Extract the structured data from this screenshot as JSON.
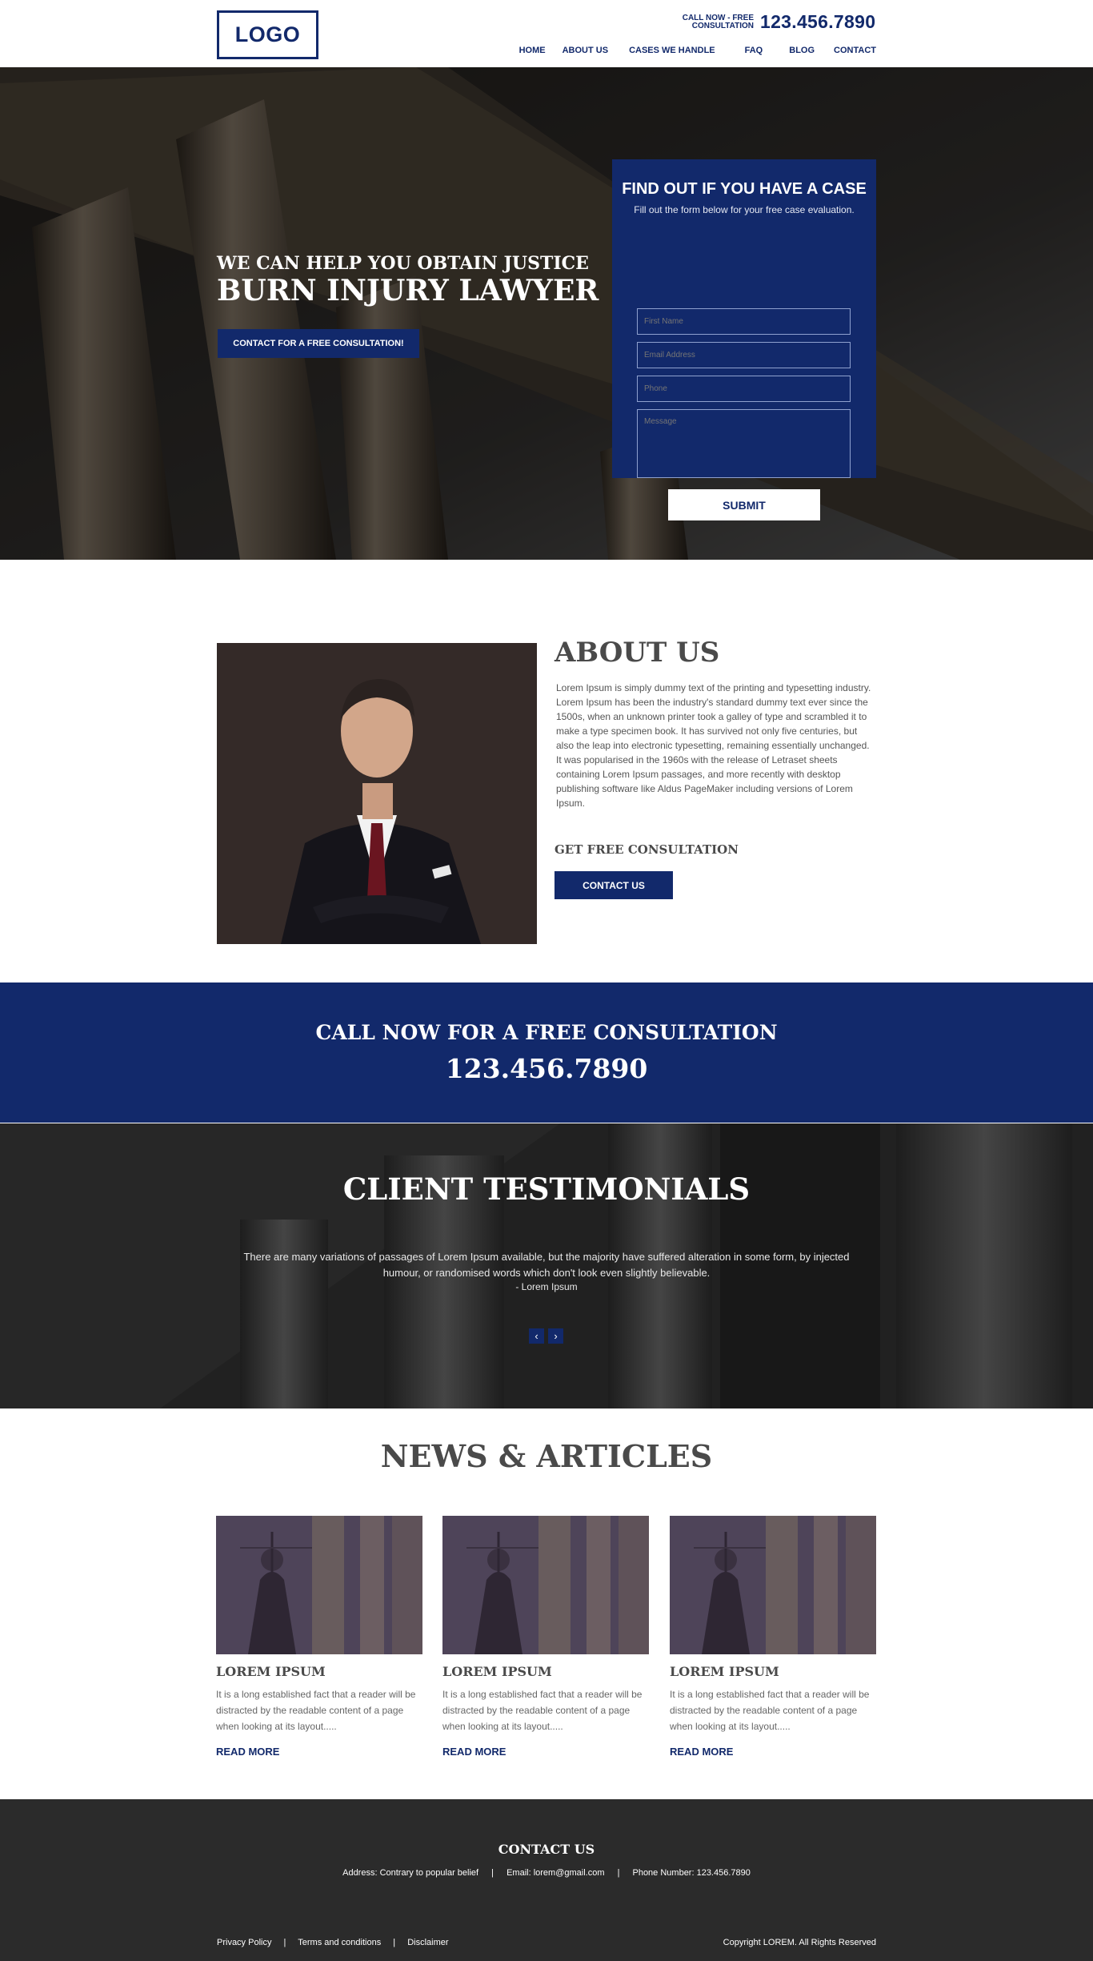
{
  "header": {
    "logo": "LOGO",
    "call_label": "CALL NOW - FREE CONSULTATION",
    "phone": "123.456.7890",
    "nav": [
      "HOME",
      "ABOUT US",
      "CASES WE HANDLE",
      "FAQ",
      "BLOG",
      "CONTACT"
    ]
  },
  "hero": {
    "subtitle": "WE CAN HELP YOU OBTAIN JUSTICE",
    "title": "BURN INJURY LAWYER",
    "cta": "CONTACT FOR A FREE CONSULTATION!"
  },
  "form": {
    "title": "FIND OUT IF YOU HAVE A CASE",
    "subtitle": "Fill out the form below for your free case evaluation.",
    "first_name_placeholder": "First Name",
    "email_placeholder": "Email Address",
    "phone_placeholder": "Phone",
    "message_placeholder": "Message",
    "submit": "SUBMIT"
  },
  "about": {
    "title": "ABOUT US",
    "text": "Lorem Ipsum is simply dummy text of the printing and typesetting industry. Lorem Ipsum has been the industry's standard dummy text ever since the 1500s, when an unknown printer took a galley of type and scrambled it to make a type specimen book. It has survived not only five centuries, but also the leap into electronic typesetting, remaining essentially unchanged. It was popularised in the 1960s with the release of Letraset sheets containing Lorem Ipsum passages, and more recently with desktop publishing software like Aldus PageMaker including versions of Lorem Ipsum.",
    "consult_label": "GET FREE CONSULTATION",
    "button": "CONTACT US"
  },
  "call_band": {
    "title": "CALL NOW FOR A FREE CONSULTATION",
    "phone": "123.456.7890"
  },
  "testimonials": {
    "title": "CLIENT TESTIMONIALS",
    "quote": "There are many variations of passages of Lorem Ipsum available, but the majority have suffered alteration in some form, by injected humour, or randomised words which don't look even slightly believable.",
    "author": "- Lorem Ipsum",
    "prev": "‹",
    "next": "›"
  },
  "news": {
    "title": "NEWS & ARTICLES",
    "cards": [
      {
        "title": "LOREM IPSUM",
        "text": "It is a long established fact that a reader will be distracted by the readable content of a page when looking at its layout.....",
        "link": "READ MORE"
      },
      {
        "title": "LOREM IPSUM",
        "text": "It is a long established fact that a reader will be distracted by the readable content of a page when looking at its layout.....",
        "link": "READ MORE"
      },
      {
        "title": "LOREM IPSUM",
        "text": "It is a long established fact that a reader will be distracted by the readable content of a page when looking at its layout.....",
        "link": "READ MORE"
      }
    ]
  },
  "footer": {
    "title": "CONTACT US",
    "address": "Address: Contrary to popular belief",
    "email": "Email: lorem@gmail.com",
    "phone": "Phone Number: 123.456.7890",
    "separator": "|",
    "links": [
      "Privacy Policy",
      "Terms and conditions",
      "Disclaimer"
    ],
    "copyright": "Copyright LOREM. All Rights Reserved"
  },
  "colors": {
    "brand_navy": "#12296b",
    "footer_bg": "#2b2b2b",
    "text_dark": "#4a4a4a"
  }
}
